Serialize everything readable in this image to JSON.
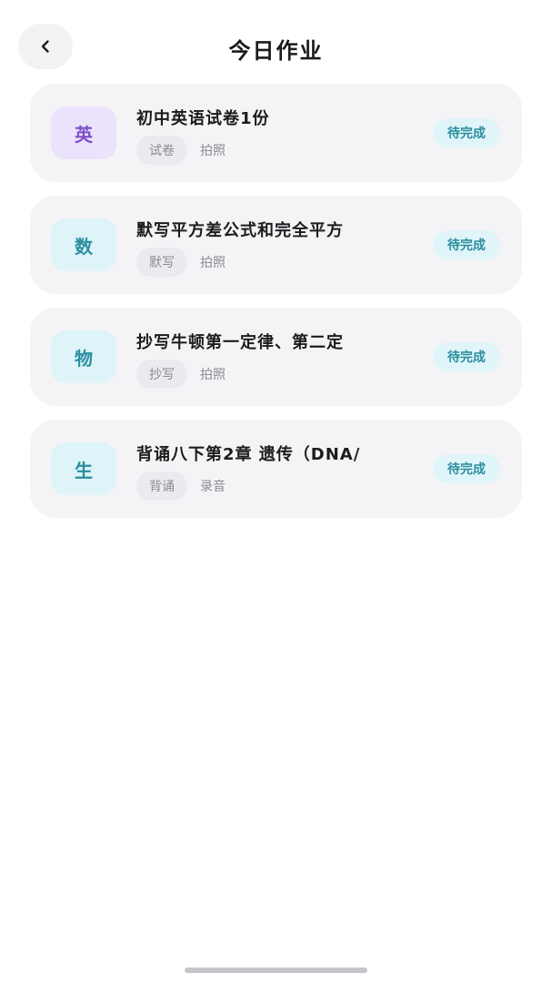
{
  "header": {
    "title": "今日作业",
    "back_icon": "chevron-left-icon"
  },
  "assignments": [
    {
      "subject": "英",
      "subject_color": "#7a4fc9",
      "title": "初中英语试卷1份",
      "tag": "试卷",
      "method": "拍照",
      "status": "待完成"
    },
    {
      "subject": "数",
      "subject_color": "#2a8ea0",
      "title": "默写平方差公式和完全平方",
      "tag": "默写",
      "method": "拍照",
      "status": "待完成"
    },
    {
      "subject": "物",
      "subject_color": "#2a8ea0",
      "title": "抄写牛顿第一定律、第二定",
      "tag": "抄写",
      "method": "拍照",
      "status": "待完成"
    },
    {
      "subject": "生",
      "subject_color": "#2a8ea0",
      "title": "背诵八下第2章 遗传（DNA/",
      "tag": "背诵",
      "method": "录音",
      "status": "待完成"
    }
  ],
  "colors": {
    "accent_teal": "#2a8ea0",
    "accent_purple": "#7a4fc9",
    "card_bg": "#f4f4f7"
  }
}
